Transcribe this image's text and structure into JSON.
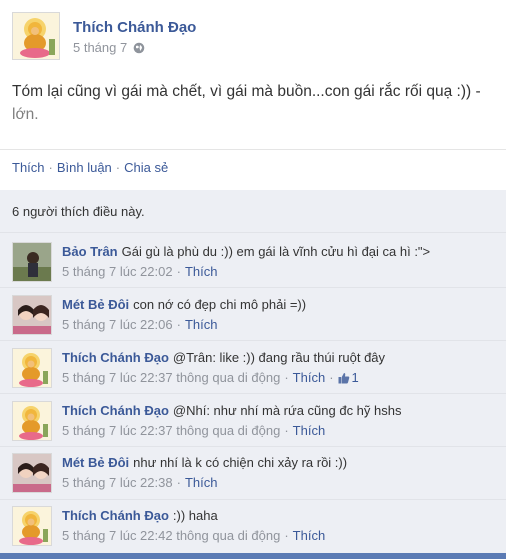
{
  "post": {
    "author": "Thích Chánh Đạo",
    "date": "5 tháng 7",
    "text_line1": "Tóm lại cũng vì gái mà chết, vì gái mà buồn...con gái rắc rối quạ :)) -",
    "text_line2": "lớn."
  },
  "actions": {
    "like": "Thích",
    "comment": "Bình luận",
    "share": "Chia sẻ"
  },
  "likes_summary": "6 người thích điều này.",
  "comments": [
    {
      "author": "Bảo Trân",
      "text": "Gái gù là phù du :)) em gái là vĩnh cửu hì đại ca hì :\">",
      "time": "5 tháng 7 lúc 22:02",
      "via": "",
      "like_label": "Thích",
      "like_count": ""
    },
    {
      "author": "Mét Bẻ Đôi",
      "text": "con nớ có đẹp chi mô phải =))",
      "time": "5 tháng 7 lúc 22:06",
      "via": "",
      "like_label": "Thích",
      "like_count": ""
    },
    {
      "author": "Thích Chánh Đạo",
      "text": "@Trân: like :)) đang rầu thúi ruột đây",
      "time": "5 tháng 7 lúc 22:37",
      "via": "thông qua di động",
      "like_label": "Thích",
      "like_count": "1"
    },
    {
      "author": "Thích Chánh Đạo",
      "text": "@Nhí: như nhí mà rứa cũng đc hỹ hshs",
      "time": "5 tháng 7 lúc 22:37",
      "via": "thông qua di động",
      "like_label": "Thích",
      "like_count": ""
    },
    {
      "author": "Mét Bẻ Đôi",
      "text": "như nhí là k có chiện chi xảy ra rồi :))",
      "time": "5 tháng 7 lúc 22:38",
      "via": "",
      "like_label": "Thích",
      "like_count": ""
    },
    {
      "author": "Thích Chánh Đạo",
      "text": ":)) haha",
      "time": "5 tháng 7 lúc 22:42",
      "via": "thông qua di động",
      "like_label": "Thích",
      "like_count": ""
    }
  ]
}
